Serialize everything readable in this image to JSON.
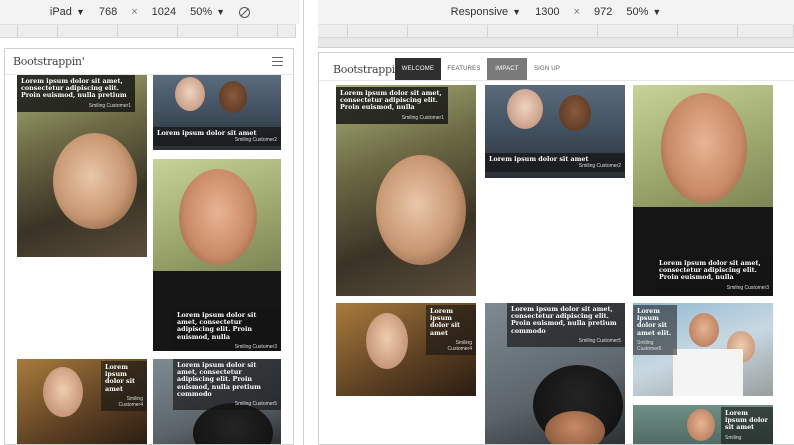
{
  "left_toolbar": {
    "device": "iPad",
    "width": "768",
    "separator": "×",
    "height": "1024",
    "zoom": "50%"
  },
  "right_toolbar": {
    "device": "Responsive",
    "width": "1300",
    "separator": "×",
    "height": "972",
    "zoom": "50%"
  },
  "site": {
    "brand": "Bootstrappin'",
    "nav": [
      "WELCOME",
      "FEATURES",
      "IMPACT",
      "SIGN UP"
    ]
  },
  "captions": {
    "c1": {
      "text": "Lorem ipsum dolor sit amet, consectetur adipiscing elit. Proin euismod, nulla pretium commodo ultricies",
      "name": "Smiling Customer1"
    },
    "c2": {
      "text": "Lorem ipsum dolor sit amet",
      "name": "Smiling Customer2"
    },
    "c3": {
      "text": "Lorem ipsum dolor sit amet, consectetur adipiscing elit. Proin euismod, nulla",
      "name": "Smiling Customer3"
    },
    "c4": {
      "text": "Lorem ipsum dolor sit amet",
      "name": "Smiling Customer4"
    },
    "c5": {
      "text": "Lorem ipsum dolor sit amet, consectetur adipiscing elit. Proin euismod, nulla pretium commodo",
      "name": "Smiling Customer5"
    },
    "c6": {
      "text": "Lorem ipsum dolor sit amet elit.",
      "name": "Smiling Customer6"
    },
    "c7": {
      "text": "Lorem ipsum dolor sit amet",
      "name": "Smiling"
    }
  },
  "colors": {
    "dark_caption": "#141414",
    "nav_active": "#2f2f2f",
    "nav_impact": "#7a7a7a"
  }
}
